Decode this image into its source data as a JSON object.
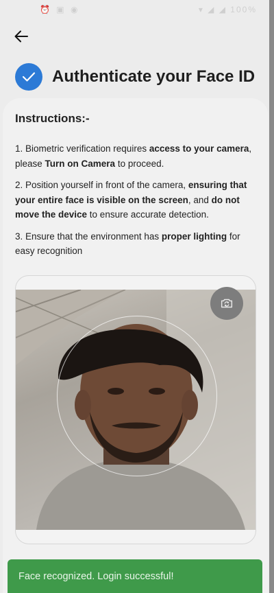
{
  "statusbar": {
    "time": "",
    "left_icons": "⏰ ▣ ◉",
    "right_icons": "▾ ◢ ◢ 100%"
  },
  "header": {
    "title": "Authenticate your Face ID"
  },
  "instructions": {
    "title": "Instructions:-",
    "items": [
      {
        "p1": "1. Biometric verification requires ",
        "b1": "access to your camera",
        "p2": ", please ",
        "b2": "Turn on Camera",
        "p3": " to proceed."
      },
      {
        "p1": "2. Position yourself in front of the camera, ",
        "b1": "ensuring that your entire face is visible on the screen",
        "p2": ", and ",
        "b2": "do not move the device",
        "p3": " to ensure accurate detection."
      },
      {
        "p1": "3. Ensure that the environment has ",
        "b1": "proper lighting",
        "p2": " for easy recognition"
      }
    ]
  },
  "camera": {
    "switch_icon": "camera-switch-icon"
  },
  "toast": {
    "message": "Face recognized. Login successful!"
  },
  "colors": {
    "accent": "#2c7ad6",
    "success": "#3f9a4a"
  }
}
